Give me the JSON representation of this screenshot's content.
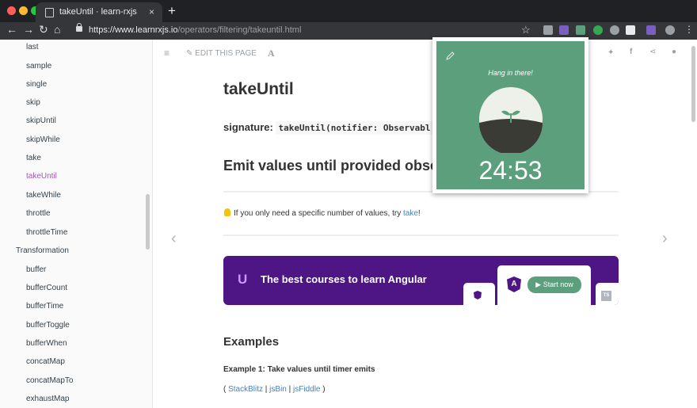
{
  "browser": {
    "tab_title": "takeUntil · learn-rxjs",
    "tab_close": "×",
    "new_tab": "+",
    "url_host": "https://www.learnrxjs.io",
    "url_path": "/operators/filtering/takeuntil.html",
    "back_icon": "←",
    "forward_icon": "→",
    "reload_icon": "↻",
    "home_icon": "⌂",
    "star_icon": "☆"
  },
  "sidebar": {
    "items": [
      {
        "label": "last",
        "type": "child"
      },
      {
        "label": "sample",
        "type": "child"
      },
      {
        "label": "single",
        "type": "child"
      },
      {
        "label": "skip",
        "type": "child"
      },
      {
        "label": "skipUntil",
        "type": "child"
      },
      {
        "label": "skipWhile",
        "type": "child"
      },
      {
        "label": "take",
        "type": "child"
      },
      {
        "label": "takeUntil",
        "type": "child",
        "active": true
      },
      {
        "label": "takeWhile",
        "type": "child"
      },
      {
        "label": "throttle",
        "type": "child"
      },
      {
        "label": "throttleTime",
        "type": "child"
      },
      {
        "label": "Transformation",
        "type": "section"
      },
      {
        "label": "buffer",
        "type": "child"
      },
      {
        "label": "bufferCount",
        "type": "child"
      },
      {
        "label": "bufferTime",
        "type": "child"
      },
      {
        "label": "bufferToggle",
        "type": "child"
      },
      {
        "label": "bufferWhen",
        "type": "child"
      },
      {
        "label": "concatMap",
        "type": "child"
      },
      {
        "label": "concatMapTo",
        "type": "child"
      },
      {
        "label": "exhaustMap",
        "type": "child"
      }
    ]
  },
  "page_toolbar": {
    "edit_label": "EDIT THIS PAGE",
    "font_label": "A"
  },
  "content": {
    "title": "takeUntil",
    "signature_label": "signature:",
    "signature_code": "takeUntil(notifier: Observabl",
    "heading": "Emit values until provided obse",
    "tip_prefix": "If you only need a specific number of values, try ",
    "tip_link": "take",
    "tip_suffix": "!",
    "banner_logo": "U",
    "banner_text": "The best courses to learn Angular",
    "banner_start": "▶ Start now",
    "banner_angular_letter": "A",
    "banner_ts": "TS",
    "examples_heading": "Examples",
    "example1_title": "Example 1: Take values until timer emits",
    "links_open": "( ",
    "link1": "StackBlitz",
    "sep1": " | ",
    "link2": "jsBin",
    "sep2": " | ",
    "link3": "jsFiddle",
    "links_close": " )"
  },
  "popup": {
    "message": "Hang in there!",
    "timer": "24:53"
  },
  "colors": {
    "popup_green": "#5c9f7c",
    "banner_purple": "#4e1585",
    "link_blue": "#4183c4",
    "active_item": "#9b59b6"
  }
}
